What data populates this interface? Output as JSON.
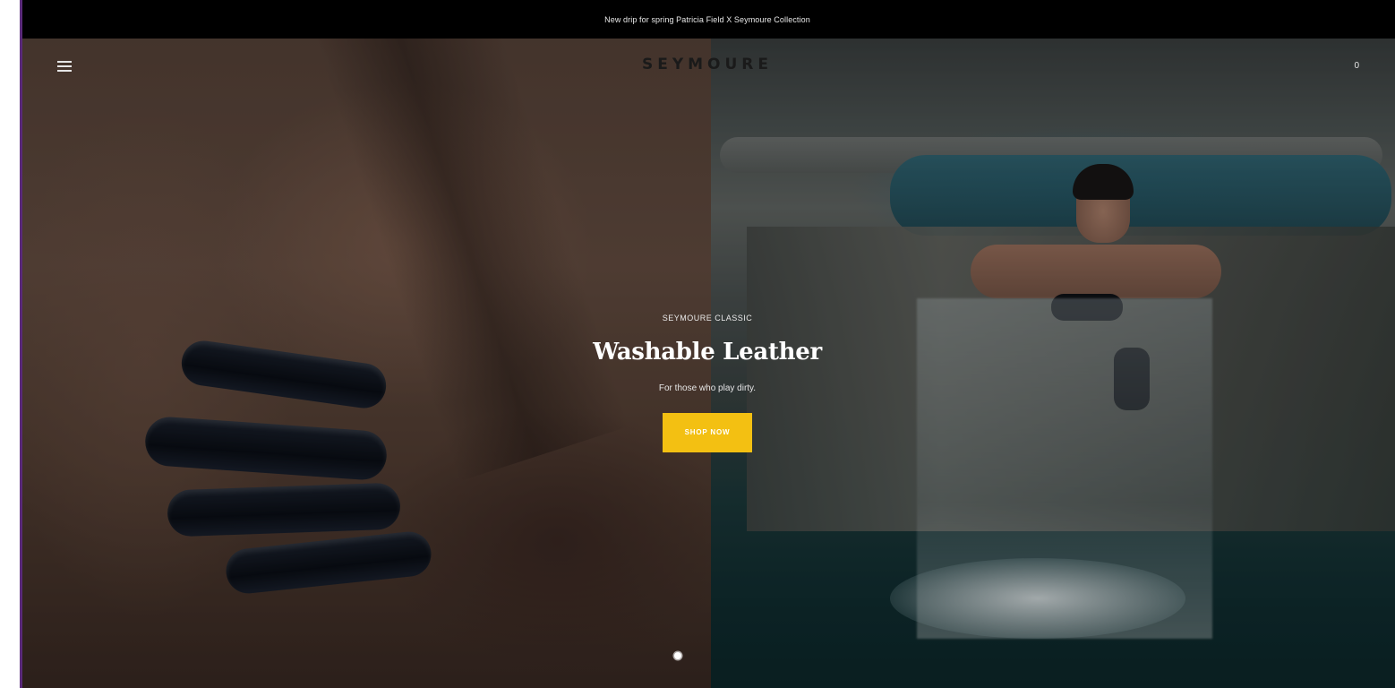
{
  "announcement": {
    "text": "New drip for spring Patricia Field X Seymoure Collection"
  },
  "header": {
    "logo": "SEYMOURE",
    "menu_icon": "hamburger-menu-icon",
    "cart_count": "0"
  },
  "hero": {
    "eyebrow": "SEYMOURE CLASSIC",
    "title": "Washable Leather",
    "subtitle": "For those who play dirty.",
    "cta_label": "SHOP NOW",
    "cta_color": "#f3c012",
    "slide_indicator_icon": "slide-dot-icon"
  }
}
